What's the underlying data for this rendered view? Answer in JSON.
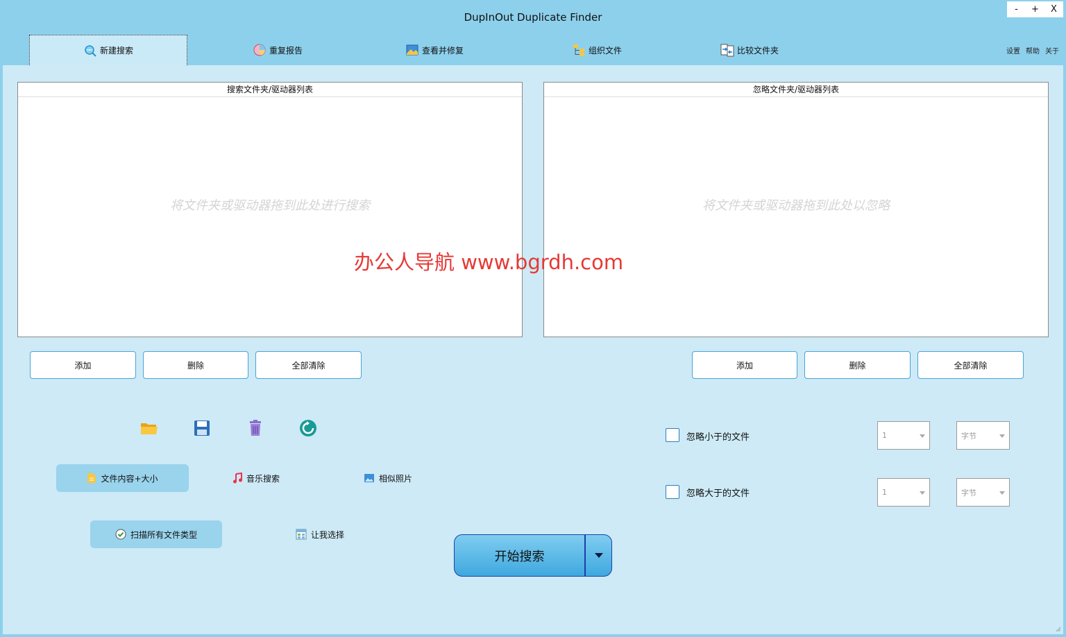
{
  "window": {
    "title": "DupInOut Duplicate Finder",
    "minimize": "-",
    "maximize": "+",
    "close": "X"
  },
  "tabs": [
    {
      "label": "新建搜索",
      "icon": "search-bubble-icon"
    },
    {
      "label": "重复报告",
      "icon": "pie-chart-icon"
    },
    {
      "label": "查看并修复",
      "icon": "picture-icon"
    },
    {
      "label": "组织文件",
      "icon": "folder-tree-icon"
    },
    {
      "label": "比较文件夹",
      "icon": "compare-files-icon"
    }
  ],
  "top_links": {
    "settings": "设置",
    "help": "帮助",
    "about": "关于"
  },
  "search_list": {
    "header": "搜索文件夹/驱动器列表",
    "placeholder": "将文件夹或驱动器拖到此处进行搜索",
    "buttons": {
      "add": "添加",
      "delete": "删除",
      "clear_all": "全部清除"
    }
  },
  "ignore_list": {
    "header": "忽略文件夹/驱动器列表",
    "placeholder": "将文件夹或驱动器拖到此处以忽略",
    "buttons": {
      "add": "添加",
      "delete": "删除",
      "clear_all": "全部清除"
    }
  },
  "toolbar_icons": [
    "folder-open-icon",
    "save-icon",
    "trash-icon",
    "refresh-icon"
  ],
  "search_modes": {
    "content_size": "文件内容+大小",
    "music": "音乐搜索",
    "photos": "相似照片"
  },
  "file_types": {
    "scan_all": "扫描所有文件类型",
    "let_me_choose": "让我选择"
  },
  "filters": {
    "ignore_smaller": {
      "label": "忽略小于的文件",
      "value": "1",
      "unit": "字节",
      "checked": false
    },
    "ignore_larger": {
      "label": "忽略大于的文件",
      "value": "1",
      "unit": "字节",
      "checked": false
    }
  },
  "start_button": "开始搜索",
  "watermark": "办公人导航 www.bgrdh.com",
  "colors": {
    "frame": "#8dd0ec",
    "panel": "#cdeaf6",
    "accent_border": "#4aa3d8",
    "start_button": "#4fb3e6",
    "watermark": "#e53935"
  }
}
